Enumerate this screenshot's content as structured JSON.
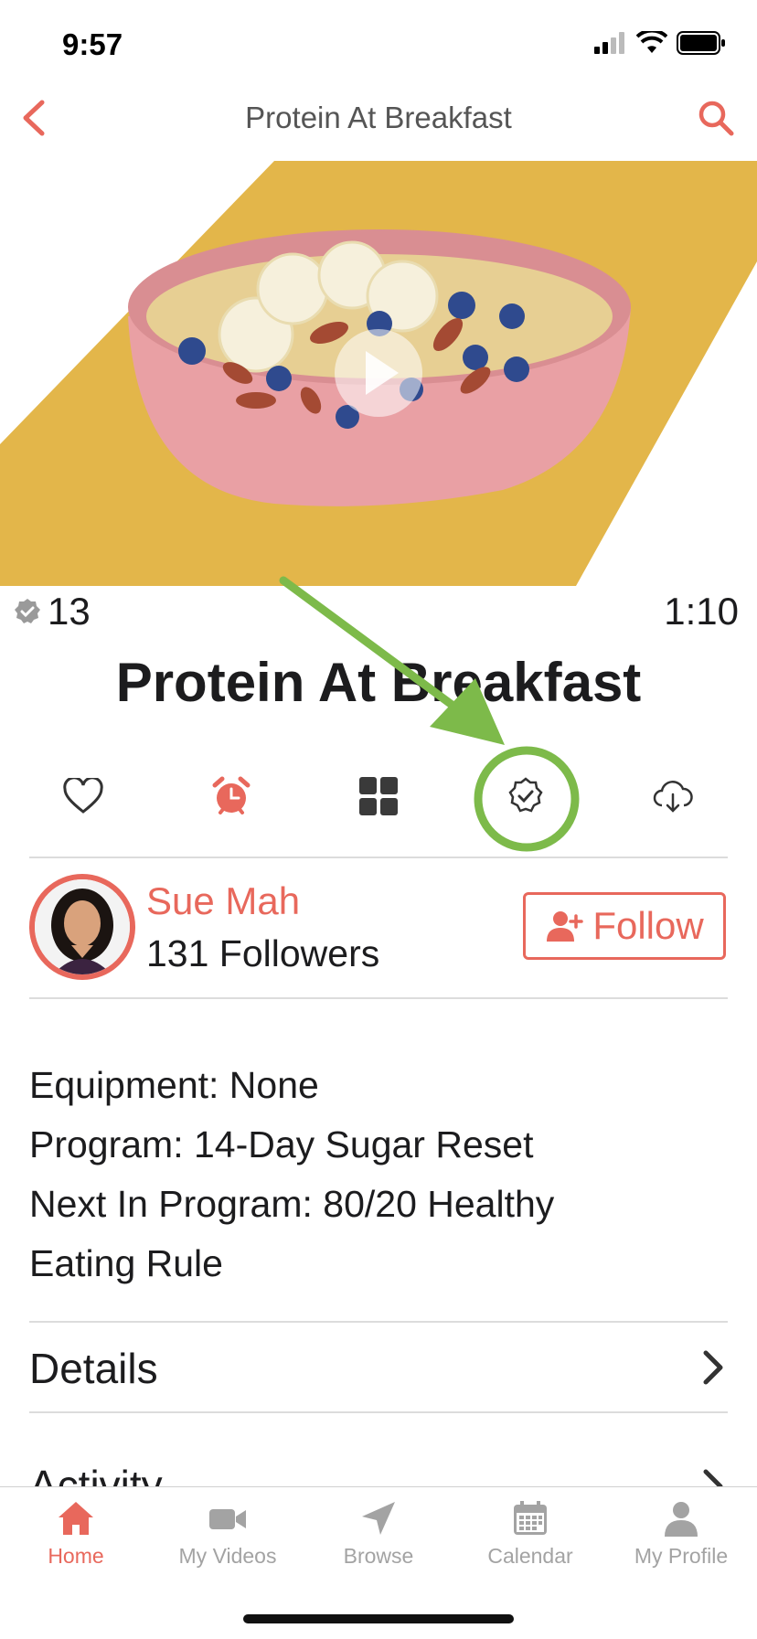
{
  "status": {
    "time": "9:57"
  },
  "nav": {
    "title": "Protein At Breakfast",
    "back_icon": "chevron-left-icon",
    "search_icon": "search-icon",
    "accent": "#e8685c"
  },
  "video": {
    "badge_count": "13",
    "duration": "1:10",
    "title": "Protein At Breakfast"
  },
  "actions": [
    "heart-icon",
    "alarm-clock-icon",
    "grid-icon",
    "check-badge-icon",
    "cloud-download-icon"
  ],
  "author": {
    "name": "Sue Mah",
    "followers": "131 Followers",
    "follow_label": "Follow"
  },
  "info": {
    "equipment": "Equipment: None",
    "program": "Program: 14-Day Sugar Reset",
    "next_line1": "Next In Program: 80/20 Healthy",
    "next_line2": "Eating Rule"
  },
  "rows": {
    "details": "Details",
    "activity": "Activity"
  },
  "tabbar": {
    "items": [
      {
        "label": "Home",
        "icon": "home-icon",
        "active": true
      },
      {
        "label": "My Videos",
        "icon": "video-camera-icon",
        "active": false
      },
      {
        "label": "Browse",
        "icon": "navigation-arrow-icon",
        "active": false
      },
      {
        "label": "Calendar",
        "icon": "calendar-icon",
        "active": false
      },
      {
        "label": "My Profile",
        "icon": "person-icon",
        "active": false
      }
    ]
  },
  "colors": {
    "accent": "#e8685c",
    "hero_bg": "#e3b64a",
    "bowl": "#e9a0a4",
    "annotation": "#7dba4a"
  }
}
